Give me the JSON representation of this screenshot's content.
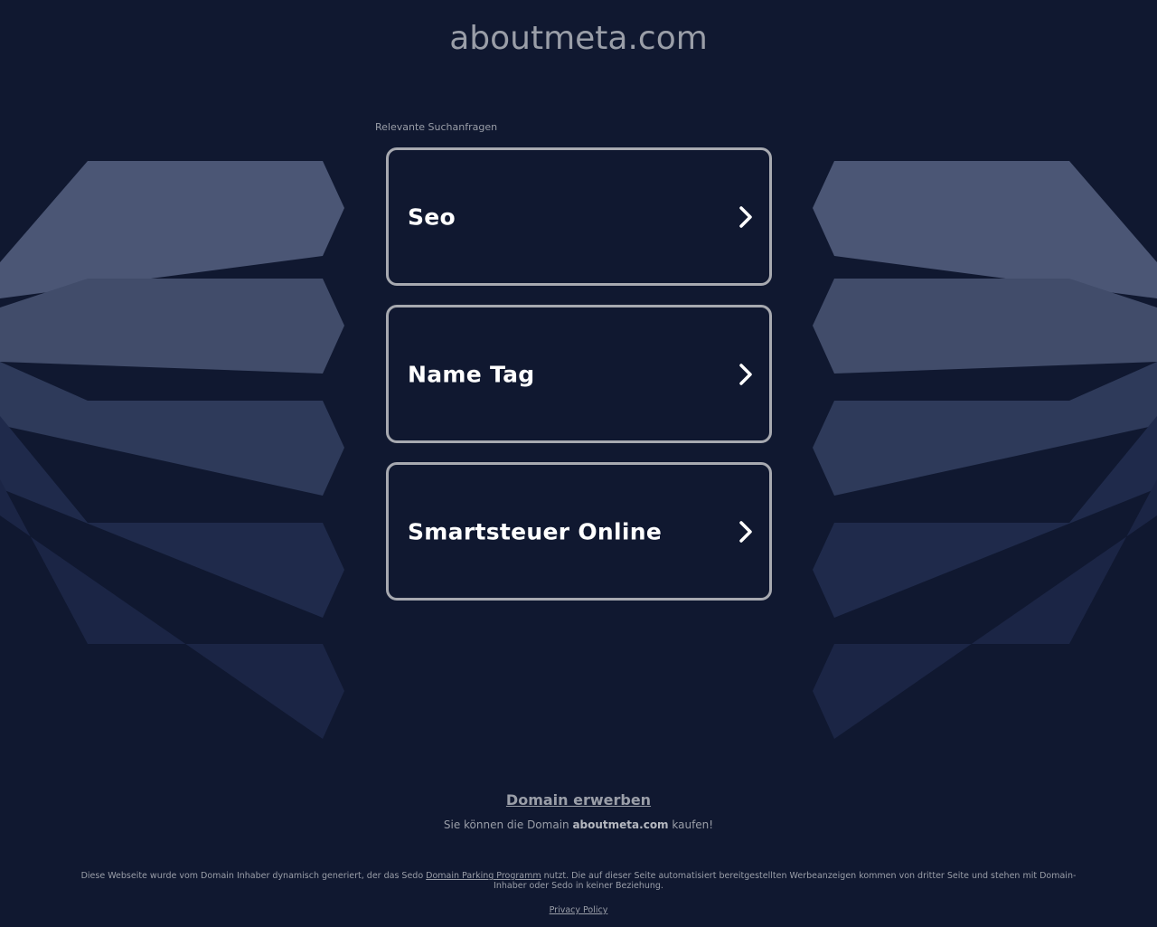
{
  "header": {
    "domain_title": "aboutmeta.com"
  },
  "related": {
    "label": "Relevante Suchanfragen",
    "items": [
      {
        "label": "Seo"
      },
      {
        "label": "Name Tag"
      },
      {
        "label": "Smartsteuer Online"
      }
    ]
  },
  "buy": {
    "link_label": "Domain erwerben",
    "text_before": "Sie können die Domain ",
    "domain": "aboutmeta.com",
    "text_after": " kaufen!"
  },
  "footer": {
    "disclaimer_before": "Diese Webseite wurde vom Domain Inhaber dynamisch generiert, der das Sedo ",
    "disclaimer_link": "Domain Parking Programm",
    "disclaimer_after": " nutzt. Die auf dieser Seite automatisiert bereitgestellten Werbeanzeigen kommen von dritter Seite und stehen mit Domain-Inhaber oder Sedo in keiner Beziehung.",
    "privacy_label": "Privacy Policy"
  },
  "colors": {
    "background": "#101830",
    "card_border": "#a7a9b0",
    "text_muted": "#9a9ea8",
    "shape_light": "#4b5675",
    "shape_dark": "#1b2545"
  },
  "icons": {
    "card_arrow": "chevron-right-icon"
  }
}
